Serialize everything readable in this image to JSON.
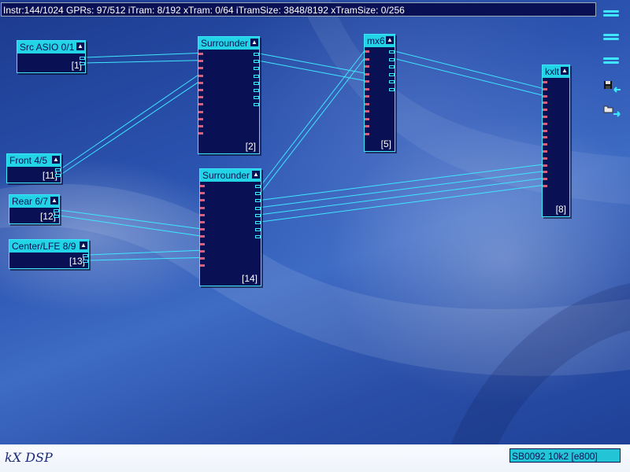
{
  "status_line": "Instr:144/1024 GPRs: 97/512 iTram: 8/192 xTram: 0/64 iTramSize: 3848/8192 xTramSize: 0/256",
  "blocks": [
    {
      "id": "src",
      "title": "Src ASIO 0/1",
      "number": "[1]",
      "inputs": 0,
      "outputs": 2
    },
    {
      "id": "front",
      "title": "Front 4/5",
      "number": "[11]",
      "inputs": 0,
      "outputs": 2
    },
    {
      "id": "rear",
      "title": "Rear 6/7",
      "number": "[12]",
      "inputs": 0,
      "outputs": 2
    },
    {
      "id": "center",
      "title": "Center/LFE 8/9",
      "number": "[13]",
      "inputs": 0,
      "outputs": 2
    },
    {
      "id": "sur2",
      "title": "Surrounder",
      "number": "[2]",
      "inputs": 12,
      "outputs": 8
    },
    {
      "id": "sur14",
      "title": "Surrounder",
      "number": "[14]",
      "inputs": 12,
      "outputs": 8
    },
    {
      "id": "mx6",
      "title": "mx6",
      "number": "[5]",
      "inputs": 12,
      "outputs": 6
    },
    {
      "id": "kxlt",
      "title": "kxlt",
      "number": "[8]",
      "inputs": 16,
      "outputs": 0
    }
  ],
  "toolbar": {
    "icons": [
      "menu-icon",
      "menu-icon",
      "menu-icon",
      "save-settings-icon",
      "load-settings-icon"
    ],
    "colors": {
      "accent": "#22d4e6",
      "block_bg": "#0a1054",
      "wire": "#3ee6ff",
      "input_pin": "#d8607a"
    }
  },
  "footer": {
    "logo": "kX DSP",
    "device": "SB0092 10k2 [e800]"
  }
}
